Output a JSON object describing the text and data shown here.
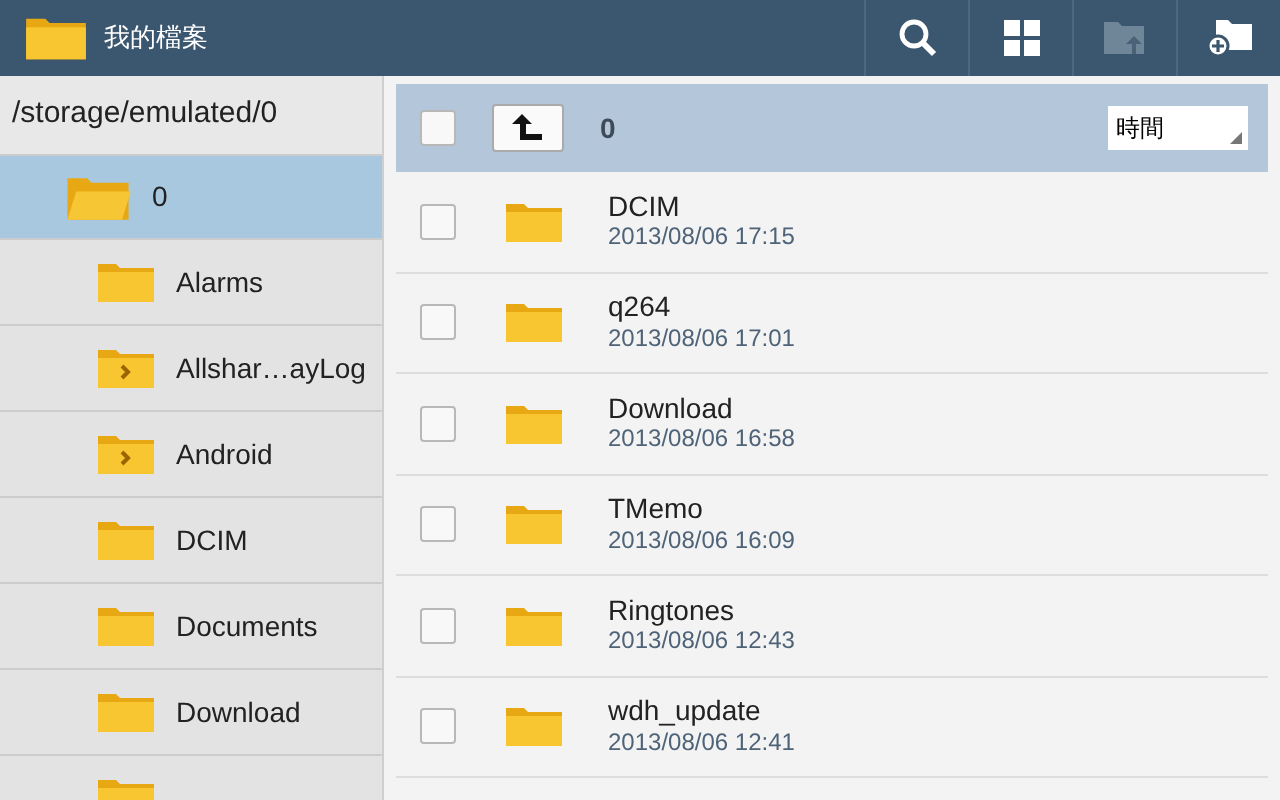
{
  "title_bar": {
    "title": "我的檔案"
  },
  "sidebar": {
    "path": "/storage/emulated/0",
    "tree": [
      {
        "label": "0",
        "selected": true,
        "expandable": false,
        "children": [
          {
            "label": "Alarms",
            "selected": false,
            "expandable": false
          },
          {
            "label": "Allshar…ayLog",
            "selected": false,
            "expandable": true
          },
          {
            "label": "Android",
            "selected": false,
            "expandable": true
          },
          {
            "label": "DCIM",
            "selected": false,
            "expandable": false
          },
          {
            "label": "Documents",
            "selected": false,
            "expandable": false
          },
          {
            "label": "Download",
            "selected": false,
            "expandable": false
          },
          {
            "selected": false,
            "expandable": false
          }
        ]
      }
    ]
  },
  "list_header": {
    "checked": false,
    "folder": "0",
    "sort": "時間"
  },
  "files": [
    {
      "name": "DCIM",
      "date": "2013/08/06 17:15",
      "checked": false
    },
    {
      "name": "q264",
      "date": "2013/08/06 17:01",
      "checked": false
    },
    {
      "name": "Download",
      "date": "2013/08/06 16:58",
      "checked": false
    },
    {
      "name": "TMemo",
      "date": "2013/08/06 16:09",
      "checked": false
    },
    {
      "name": "Ringtones",
      "date": "2013/08/06 12:43",
      "checked": false
    },
    {
      "name": "wdh_update",
      "date": "2013/08/06 12:41",
      "checked": false
    }
  ]
}
